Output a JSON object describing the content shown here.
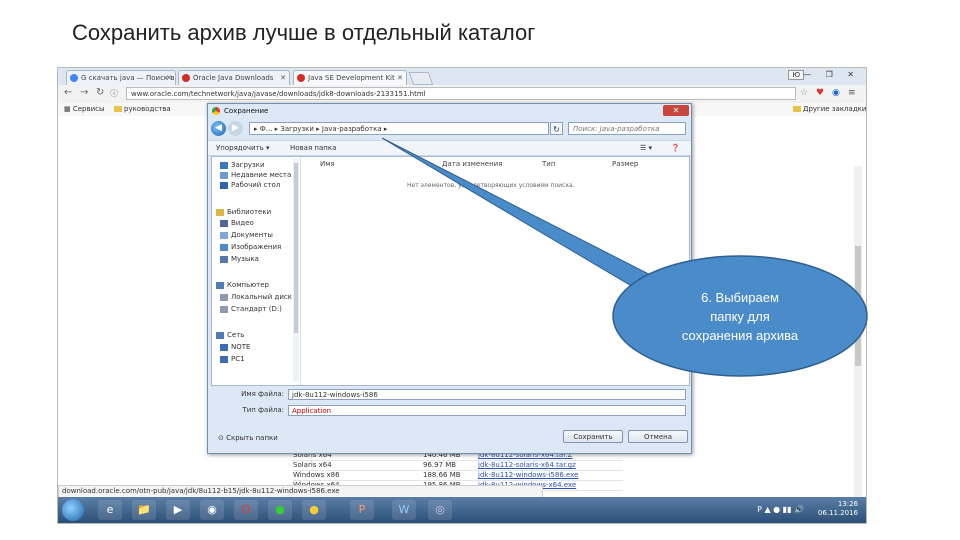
{
  "slide": {
    "title": "Сохранить архив лучше в отдельный каталог"
  },
  "browser": {
    "tabs": [
      {
        "label": "G скачать java — Поиск в",
        "icon_color": "#4285f4"
      },
      {
        "label": "Oracle Java Downloads",
        "icon_color": "#d62b23"
      },
      {
        "label": "Java SE Development Kit",
        "icon_color": "#d62b23"
      }
    ],
    "user_label": "Ю",
    "window_controls": "— ❐ ✕",
    "url": "www.oracle.com/technetwork/java/javase/downloads/jdk8-downloads-2133151.html",
    "bookmarks": [
      "Сервисы",
      "руководства",
      "Другие закладки"
    ]
  },
  "page_behind": {
    "rows": [
      {
        "name": "Solaris x64",
        "size": "140.46 MB",
        "file": "jdk-8u112-solaris-x64.tar.Z"
      },
      {
        "name": "Solaris x64",
        "size": "96.97 MB",
        "file": "jdk-8u112-solaris-x64.tar.gz"
      },
      {
        "name": "Windows x86",
        "size": "188.66 MB",
        "file": "jdk-8u112-windows-i586.exe"
      },
      {
        "name": "Windows x64",
        "size": "195.86 MB",
        "file": "jdk-8u112-windows-x64.exe"
      }
    ],
    "status_url": "download.oracle.com/otn-pub/java/jdk/8u112-b15/jdk-8u112-windows-i586.exe"
  },
  "taskbar": {
    "apps": [
      "⊞",
      "e",
      "📁",
      "▶",
      "◉",
      "O",
      "●",
      "●",
      "P",
      "W",
      "◎"
    ],
    "lang": "Р",
    "time": "13:26",
    "date": "06.11.2016"
  },
  "dialog": {
    "title": "Сохранение",
    "path": "▸ Ф... ▸ Загрузки ▸ Java-разработка ▸",
    "search_placeholder": "Поиск: Java-разработка",
    "toolbar": {
      "organize": "Упорядочить ▾",
      "new_folder": "Новая папка"
    },
    "nav_items": [
      {
        "label": "Загрузки",
        "group": "fav",
        "color": "#3b78c4"
      },
      {
        "label": "Недавние места",
        "group": "fav",
        "color": "#6a9bd2"
      },
      {
        "label": "Рабочий стол",
        "group": "fav",
        "color": "#2f64a8"
      },
      {
        "label": "Библиотеки",
        "group": "lib",
        "color": "#e2b54a"
      },
      {
        "label": "Видео",
        "group": "lib",
        "color": "#4a66a0"
      },
      {
        "label": "Документы",
        "group": "lib",
        "color": "#7fa7d6"
      },
      {
        "label": "Изображения",
        "group": "lib",
        "color": "#4c8cc8"
      },
      {
        "label": "Музыка",
        "group": "lib",
        "color": "#5577aa"
      },
      {
        "label": "Компьютер",
        "group": "pc",
        "color": "#4f7cb6"
      },
      {
        "label": "Локальный диск",
        "group": "pc",
        "color": "#8a9bb0"
      },
      {
        "label": "Стандарт (D:)",
        "group": "pc",
        "color": "#8a9bb0"
      },
      {
        "label": "Сеть",
        "group": "net",
        "color": "#4f7cb6"
      },
      {
        "label": "NOTE",
        "group": "net",
        "color": "#3b6db0"
      },
      {
        "label": "PC1",
        "group": "net",
        "color": "#3b6db0"
      }
    ],
    "columns": [
      "Имя",
      "Дата изменения",
      "Тип",
      "Размер"
    ],
    "empty_message": "Нет элементов, удовлетворяющих условиям поиска.",
    "filename_label": "Имя файла:",
    "filename_value": "jdk-8u112-windows-i586",
    "filetype_label": "Тип файла:",
    "filetype_value": "Application",
    "hide_folders": "Скрыть папки",
    "save_button": "Сохранить",
    "cancel_button": "Отмена"
  },
  "callout": {
    "line1": "6. Выбираем",
    "line2": "папку для",
    "line3": "сохранения архива",
    "fill": "#4a8bc9"
  }
}
